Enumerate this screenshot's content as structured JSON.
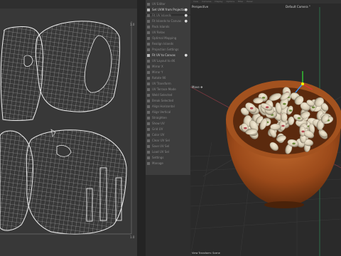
{
  "uv_editor": {
    "tick_top": "1.0",
    "tick_bottom": "1.0"
  },
  "panel": {
    "items": [
      {
        "label": "UV Editor",
        "hi": false,
        "ck": false
      },
      {
        "label": "Set UVW from Projection",
        "hi": true,
        "ck": true
      },
      {
        "label": "Fit UV Islands",
        "hi": false,
        "ck": true
      },
      {
        "label": "Fit Islands to Canvas",
        "hi": false,
        "ck": true
      },
      {
        "label": "Pack Islands",
        "hi": false,
        "ck": false
      },
      {
        "label": "UV Relax",
        "hi": false,
        "ck": false
      },
      {
        "label": "Optimal Mapping",
        "hi": false,
        "ck": false
      },
      {
        "label": "Realign Islands",
        "hi": false,
        "ck": false
      },
      {
        "label": "Projection Settings",
        "hi": false,
        "ck": false
      },
      {
        "label": "Fit UV to Canvas",
        "hi": true,
        "ck": true
      },
      {
        "label": "UV Layout to 4K",
        "hi": false,
        "ck": false
      },
      {
        "label": "Mirror X",
        "hi": false,
        "ck": false
      },
      {
        "label": "Mirror Y",
        "hi": false,
        "ck": false
      },
      {
        "label": "Rotate 90",
        "hi": false,
        "ck": false
      },
      {
        "label": "UV Transform",
        "hi": false,
        "ck": false
      },
      {
        "label": "UV Terrace Mode",
        "hi": false,
        "ck": false
      },
      {
        "label": "Weld Selected",
        "hi": false,
        "ck": false
      },
      {
        "label": "Break Selected",
        "hi": false,
        "ck": false
      },
      {
        "label": "Align Horizontal",
        "hi": false,
        "ck": false
      },
      {
        "label": "Align Vertical",
        "hi": false,
        "ck": false
      },
      {
        "label": "Straighten",
        "hi": false,
        "ck": false
      },
      {
        "label": "Show UV",
        "hi": false,
        "ck": false
      },
      {
        "label": "Grid UV",
        "hi": false,
        "ck": false
      },
      {
        "label": "Color UV",
        "hi": false,
        "ck": false
      },
      {
        "label": "Clear UV Sel",
        "hi": false,
        "ck": false
      },
      {
        "label": "Save UV Sel",
        "hi": false,
        "ck": false
      },
      {
        "label": "Load UV Sel",
        "hi": false,
        "ck": false
      },
      {
        "label": "Settings",
        "hi": false,
        "ck": false
      },
      {
        "label": "Manage",
        "hi": false,
        "ck": false
      }
    ]
  },
  "viewport": {
    "menu": [
      "View",
      "Cameras",
      "Display",
      "Options",
      "Filter",
      "Panel"
    ],
    "title": "Perspective",
    "camera": "Default Camera °",
    "move_label": "Move ❖",
    "footer": "View Transform: Scene"
  },
  "colors": {
    "panel_hi": "#d8d8d8",
    "bowl": "#9c4a1a",
    "nut": "#d6cbb2",
    "nut_green": "#6e8a3a",
    "nut_red": "#b24a52"
  }
}
